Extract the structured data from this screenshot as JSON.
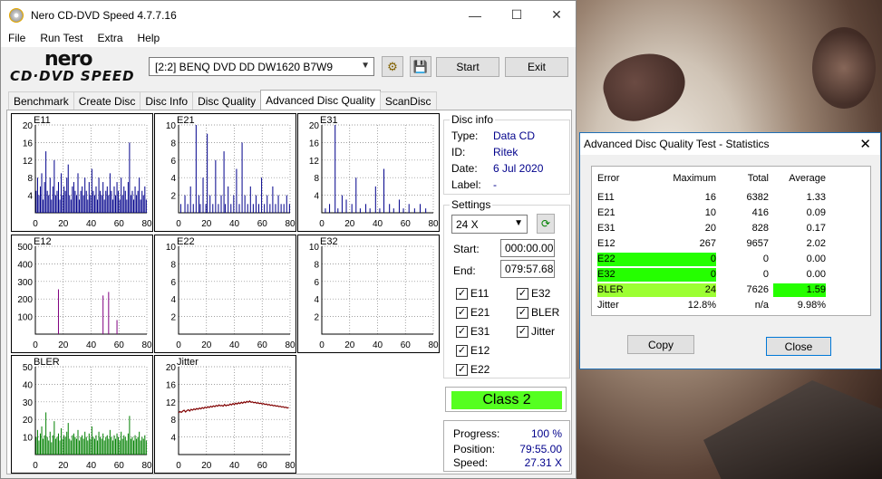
{
  "window": {
    "title": "Nero CD-DVD Speed 4.7.7.16",
    "minimize": "—",
    "maximize": "☐",
    "close": "✕"
  },
  "menu": [
    "File",
    "Run Test",
    "Extra",
    "Help"
  ],
  "logo": {
    "top": "nero",
    "bottom": "CD·DVD SPEED"
  },
  "toolbar": {
    "drive": "[2:2]   BENQ DVD DD DW1620 B7W9",
    "start_label": "Start",
    "exit_label": "Exit"
  },
  "tabs": [
    "Benchmark",
    "Create Disc",
    "Disc Info",
    "Disc Quality",
    "Advanced Disc Quality",
    "ScanDisc"
  ],
  "active_tab": "Advanced Disc Quality",
  "disc_info": {
    "heading": "Disc info",
    "type_label": "Type:",
    "type_value": "Data CD",
    "id_label": "ID:",
    "id_value": "Ritek",
    "date_label": "Date:",
    "date_value": "6 Jul 2020",
    "label_label": "Label:",
    "label_value": "-"
  },
  "settings": {
    "heading": "Settings",
    "speed": "24 X",
    "start_label": "Start:",
    "start_value": "000:00.00",
    "end_label": "End:",
    "end_value": "079:57.68",
    "checks": [
      {
        "label": "E11",
        "checked": true
      },
      {
        "label": "E32",
        "checked": true
      },
      {
        "label": "E21",
        "checked": true
      },
      {
        "label": "BLER",
        "checked": true
      },
      {
        "label": "E31",
        "checked": true
      },
      {
        "label": "Jitter",
        "checked": true
      },
      {
        "label": "E12",
        "checked": true
      },
      {
        "label": "E22",
        "checked": true
      }
    ]
  },
  "class_label": "Class 2",
  "progress": {
    "progress_label": "Progress:",
    "progress_value": "100 %",
    "position_label": "Position:",
    "position_value": "79:55.00",
    "speed_label": "Speed:",
    "speed_value": "27.31 X"
  },
  "chart_data": [
    {
      "type": "bar",
      "title": "E11",
      "x_ticks": [
        "0",
        "20",
        "40",
        "60",
        "80"
      ],
      "y_ticks": [
        "20",
        "16",
        "12",
        "8",
        "4"
      ],
      "ylim": [
        0,
        20
      ],
      "color": "#00008b",
      "values": [
        5,
        8,
        4,
        6,
        9,
        3,
        7,
        14,
        5,
        4,
        8,
        3,
        6,
        12,
        4,
        5,
        7,
        3,
        9,
        4,
        6,
        5,
        8,
        11,
        4,
        3,
        6,
        7,
        5,
        4,
        9,
        3,
        5,
        6,
        4,
        8,
        5,
        3,
        7,
        4,
        10,
        5,
        4,
        6,
        3,
        8,
        5,
        4,
        7,
        3,
        5,
        6,
        4,
        9,
        5,
        3,
        6,
        4,
        7,
        5,
        3,
        8,
        4,
        6,
        5,
        3,
        7,
        16,
        4,
        5,
        3,
        6,
        4,
        5,
        8,
        3,
        5,
        4,
        6,
        3
      ]
    },
    {
      "type": "bar",
      "title": "E21",
      "x_ticks": [
        "0",
        "20",
        "40",
        "60",
        "80"
      ],
      "y_ticks": [
        "10",
        "8",
        "6",
        "4",
        "2"
      ],
      "ylim": [
        0,
        10
      ],
      "color": "#00008b",
      "values": [
        0,
        1,
        0,
        0,
        2,
        0,
        1,
        0,
        3,
        0,
        1,
        0,
        10,
        0,
        2,
        1,
        0,
        4,
        0,
        1,
        9,
        0,
        2,
        0,
        1,
        0,
        6,
        0,
        1,
        0,
        2,
        0,
        7,
        1,
        0,
        3,
        0,
        1,
        0,
        2,
        0,
        5,
        0,
        1,
        0,
        8,
        0,
        2,
        0,
        1,
        0,
        3,
        0,
        1,
        0,
        2,
        0,
        1,
        0,
        4,
        0,
        1,
        0,
        2,
        0,
        1,
        0,
        3,
        0,
        1,
        0,
        2,
        0,
        1,
        0,
        1,
        0,
        2,
        0,
        1
      ]
    },
    {
      "type": "bar",
      "title": "E31",
      "x_ticks": [
        "0",
        "20",
        "40",
        "60",
        "80"
      ],
      "y_ticks": [
        "20",
        "16",
        "12",
        "8",
        "4"
      ],
      "ylim": [
        0,
        20
      ],
      "color": "#00008b",
      "values": [
        0,
        0,
        1,
        0,
        0,
        2,
        0,
        0,
        0,
        20,
        0,
        1,
        0,
        0,
        4,
        0,
        0,
        3,
        0,
        0,
        0,
        2,
        0,
        0,
        8,
        0,
        0,
        1,
        0,
        0,
        0,
        2,
        0,
        0,
        1,
        0,
        0,
        0,
        6,
        0,
        0,
        1,
        0,
        0,
        10,
        0,
        0,
        0,
        2,
        0,
        0,
        1,
        0,
        0,
        0,
        3,
        0,
        0,
        1,
        0,
        0,
        0,
        2,
        0,
        0,
        0,
        1,
        0,
        0,
        0,
        2,
        0,
        0,
        0,
        1,
        0,
        0,
        0,
        0,
        0
      ]
    },
    {
      "type": "bar",
      "title": "E12",
      "x_ticks": [
        "0",
        "20",
        "40",
        "60",
        "80"
      ],
      "y_ticks": [
        "500",
        "400",
        "300",
        "200",
        "100"
      ],
      "ylim": [
        0,
        500
      ],
      "color": "#800080",
      "values": [
        0,
        0,
        0,
        0,
        0,
        0,
        0,
        0,
        0,
        0,
        0,
        0,
        0,
        0,
        0,
        0,
        255,
        0,
        0,
        0,
        0,
        0,
        0,
        0,
        0,
        0,
        0,
        0,
        0,
        0,
        0,
        0,
        0,
        0,
        0,
        0,
        0,
        0,
        0,
        0,
        0,
        0,
        0,
        0,
        0,
        0,
        0,
        0,
        220,
        0,
        0,
        0,
        240,
        0,
        0,
        0,
        0,
        0,
        80,
        0,
        0,
        0,
        0,
        0,
        0,
        0,
        0,
        0,
        0,
        0,
        0,
        0,
        0,
        0,
        0,
        0,
        0,
        0,
        0,
        0
      ]
    },
    {
      "type": "bar",
      "title": "E22",
      "x_ticks": [
        "0",
        "20",
        "40",
        "60",
        "80"
      ],
      "y_ticks": [
        "10",
        "8",
        "6",
        "4",
        "2"
      ],
      "ylim": [
        0,
        10
      ],
      "color": "#00008b",
      "values": []
    },
    {
      "type": "bar",
      "title": "E32",
      "x_ticks": [
        "0",
        "20",
        "40",
        "60",
        "80"
      ],
      "y_ticks": [
        "10",
        "8",
        "6",
        "4",
        "2"
      ],
      "ylim": [
        0,
        10
      ],
      "color": "#00008b",
      "values": []
    },
    {
      "type": "bar",
      "title": "BLER",
      "x_ticks": [
        "0",
        "20",
        "40",
        "60",
        "80"
      ],
      "y_ticks": [
        "50",
        "40",
        "30",
        "20",
        "10"
      ],
      "ylim": [
        0,
        50
      ],
      "color": "#008000",
      "values": [
        10,
        14,
        8,
        12,
        16,
        9,
        11,
        24,
        10,
        8,
        13,
        7,
        11,
        19,
        9,
        10,
        12,
        8,
        15,
        9,
        11,
        10,
        13,
        18,
        9,
        8,
        11,
        12,
        10,
        9,
        14,
        8,
        10,
        11,
        9,
        13,
        10,
        8,
        12,
        9,
        16,
        10,
        9,
        11,
        8,
        13,
        10,
        9,
        12,
        8,
        10,
        11,
        9,
        14,
        10,
        8,
        11,
        9,
        12,
        10,
        8,
        13,
        9,
        11,
        10,
        8,
        12,
        22,
        9,
        10,
        8,
        11,
        9,
        10,
        13,
        8,
        10,
        9,
        11,
        8
      ]
    },
    {
      "type": "line",
      "title": "Jitter",
      "x_ticks": [
        "0",
        "20",
        "40",
        "60",
        "80"
      ],
      "y_ticks": [
        "20",
        "16",
        "12",
        "8",
        "4"
      ],
      "ylim": [
        0,
        20
      ],
      "color": "#800000",
      "values": [
        9.5,
        9.8,
        9.6,
        9.9,
        10.1,
        9.7,
        10.0,
        10.2,
        9.9,
        10.3,
        10.1,
        10.4,
        10.2,
        10.5,
        10.3,
        10.6,
        10.4,
        10.7,
        10.5,
        10.8,
        10.6,
        10.9,
        10.7,
        11.0,
        10.8,
        11.1,
        10.9,
        11.2,
        11.0,
        11.3,
        11.1,
        11.2,
        11.0,
        11.4,
        11.1,
        11.3,
        11.2,
        11.5,
        11.3,
        11.6,
        11.4,
        11.7,
        11.5,
        11.8,
        11.6,
        11.9,
        11.7,
        12.0,
        11.8,
        12.1,
        11.9,
        12.2,
        11.9,
        12.0,
        11.8,
        11.9,
        11.7,
        11.8,
        11.6,
        11.7,
        11.5,
        11.6,
        11.4,
        11.5,
        11.3,
        11.4,
        11.2,
        11.3,
        11.1,
        11.2,
        11.0,
        11.1,
        10.9,
        11.0,
        10.8,
        10.9,
        10.7,
        10.8,
        10.6,
        10.7
      ]
    }
  ],
  "stats": {
    "title": "Advanced Disc Quality Test - Statistics",
    "close": "✕",
    "headers": [
      "Error",
      "Maximum",
      "Total",
      "Average"
    ],
    "rows": [
      {
        "name": "E11",
        "max": "16",
        "total": "6382",
        "avg": "1.33"
      },
      {
        "name": "E21",
        "max": "10",
        "total": "416",
        "avg": "0.09"
      },
      {
        "name": "E31",
        "max": "20",
        "total": "828",
        "avg": "0.17"
      },
      {
        "name": "E12",
        "max": "267",
        "total": "9657",
        "avg": "2.02"
      },
      {
        "name": "E22",
        "max": "0",
        "total": "0",
        "avg": "0.00"
      },
      {
        "name": "E32",
        "max": "0",
        "total": "0",
        "avg": "0.00"
      },
      {
        "name": "BLER",
        "max": "24",
        "total": "7626",
        "avg": "1.59"
      },
      {
        "name": "Jitter",
        "max": "12.8%",
        "total": "n/a",
        "avg": "9.98%"
      }
    ],
    "copy_label": "Copy",
    "close_label": "Close"
  }
}
